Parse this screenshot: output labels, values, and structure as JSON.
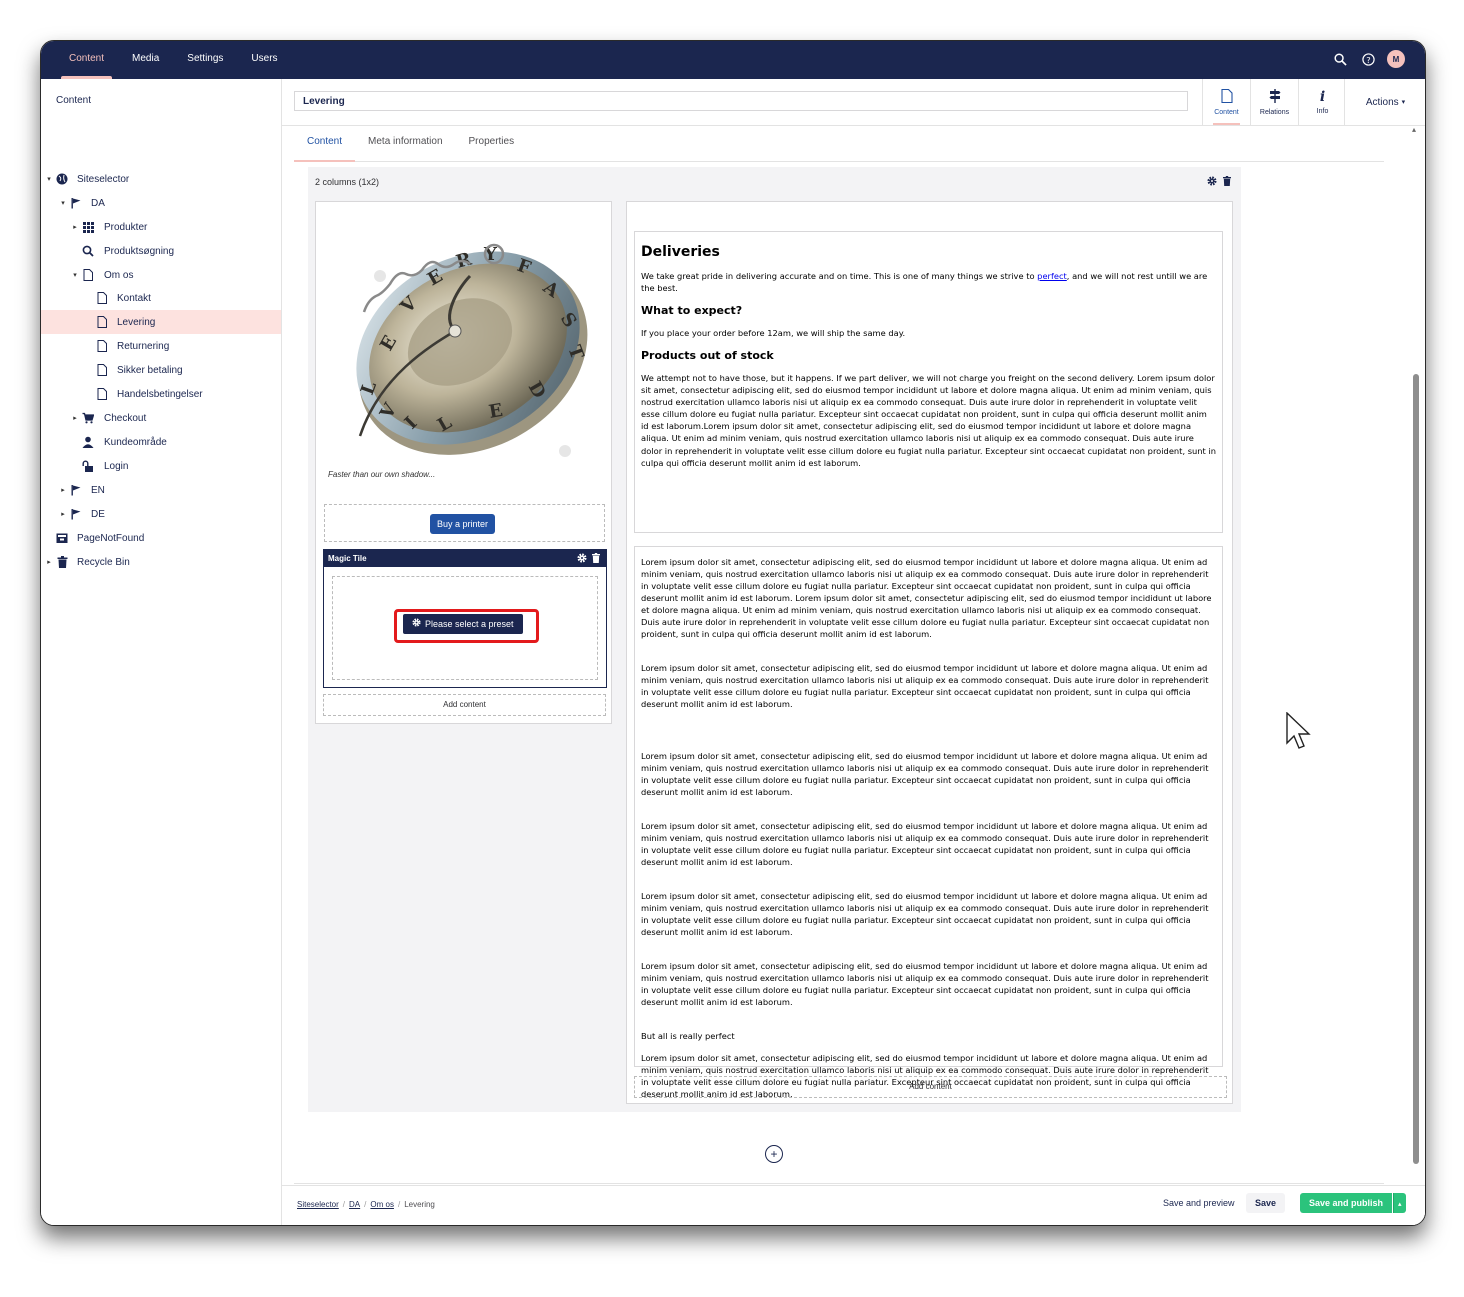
{
  "topnav": {
    "items": [
      {
        "label": "Content"
      },
      {
        "label": "Media"
      },
      {
        "label": "Settings"
      },
      {
        "label": "Users"
      }
    ],
    "avatar_initial": "M"
  },
  "sidebar": {
    "title": "Content",
    "tree": [
      {
        "label": "Siteselector",
        "icon": "globe-icon"
      },
      {
        "label": "DA",
        "icon": "flag-icon"
      },
      {
        "label": "Produkter",
        "icon": "grid-icon"
      },
      {
        "label": "Produktsøgning",
        "icon": "search-icon"
      },
      {
        "label": "Om os",
        "icon": "document-icon"
      },
      {
        "label": "Kontakt",
        "icon": "document-icon"
      },
      {
        "label": "Levering",
        "icon": "document-icon"
      },
      {
        "label": "Returnering",
        "icon": "document-icon"
      },
      {
        "label": "Sikker betaling",
        "icon": "document-icon"
      },
      {
        "label": "Handelsbetingelser",
        "icon": "document-icon"
      },
      {
        "label": "Checkout",
        "icon": "cart-icon"
      },
      {
        "label": "Kundeområde",
        "icon": "user-icon"
      },
      {
        "label": "Login",
        "icon": "unlock-icon"
      },
      {
        "label": "EN",
        "icon": "flag-icon"
      },
      {
        "label": "DE",
        "icon": "flag-icon"
      },
      {
        "label": "PageNotFound",
        "icon": "block-icon"
      },
      {
        "label": "Recycle Bin",
        "icon": "trash-icon"
      }
    ]
  },
  "header": {
    "name_value": "Levering",
    "apps": [
      {
        "label": "Content",
        "icon": "document-icon"
      },
      {
        "label": "Relations",
        "icon": "signpost-icon"
      },
      {
        "label": "Info",
        "icon": "info-icon"
      }
    ],
    "actions_label": "Actions"
  },
  "tabs": [
    {
      "label": "Content"
    },
    {
      "label": "Meta information"
    },
    {
      "label": "Properties"
    }
  ],
  "grid": {
    "row_title": "2 columns (1x2)",
    "left": {
      "watch_letters": "DELIVERY FAST",
      "caption": "Faster than our own shadow...",
      "button_label": "Buy a printer",
      "magic_tile_title": "Magic Tile",
      "preset_button_label": "Please select a preset",
      "add_content_label": "Add content"
    },
    "right": {
      "heading": "Deliveries",
      "intro_before_link": "We take great pride in delivering accurate and on time. This is one of many things we strive to ",
      "intro_link": "perfect",
      "intro_after_link": ", and we will not rest untill we are the best.",
      "subheading1": "What to expect?",
      "expect_text": "If you place your order before 12am, we will ship the same day.",
      "subheading2": "Products out of stock",
      "stock_text": "We attempt not to have those, but it happens. If we part deliver, we will not charge you freight on the second delivery. Lorem ipsum dolor sit amet, consectetur adipiscing elit, sed do eiusmod tempor incididunt ut labore et dolore magna aliqua. Ut enim ad minim veniam, quis nostrud exercitation ullamco laboris nisi ut aliquip ex ea commodo consequat. Duis aute irure dolor in reprehenderit in voluptate velit esse cillum dolore eu fugiat nulla pariatur. Excepteur sint occaecat cupidatat non proident, sunt in culpa qui officia deserunt mollit anim id est laborum.Lorem ipsum dolor sit amet, consectetur adipiscing elit, sed do eiusmod tempor incididunt ut labore et dolore magna aliqua. Ut enim ad minim veniam, quis nostrud exercitation ullamco laboris nisi ut aliquip ex ea commodo consequat. Duis aute irure dolor in reprehenderit in voluptate velit esse cillum dolore eu fugiat nulla pariatur. Excepteur sint occaecat cupidatat non proident, sunt in culpa qui officia deserunt mollit anim id est laborum.",
      "lorem_long": "Lorem ipsum dolor sit amet, consectetur adipiscing elit, sed do eiusmod tempor incididunt ut labore et dolore magna aliqua. Ut enim ad minim veniam, quis nostrud exercitation ullamco laboris nisi ut aliquip ex ea commodo consequat. Duis aute irure dolor in reprehenderit in voluptate velit esse cillum dolore eu fugiat nulla pariatur. Excepteur sint occaecat cupidatat non proident, sunt in culpa qui officia deserunt mollit anim id est laborum. Lorem ipsum dolor sit amet, consectetur adipiscing elit, sed do eiusmod tempor incididunt ut labore et dolore magna aliqua. Ut enim ad minim veniam, quis nostrud exercitation ullamco laboris nisi ut aliquip ex ea commodo consequat. Duis aute irure dolor in reprehenderit in voluptate velit esse cillum dolore eu fugiat nulla pariatur. Excepteur sint occaecat cupidatat non proident, sunt in culpa qui officia deserunt mollit anim id est laborum.",
      "lorem": "Lorem ipsum dolor sit amet, consectetur adipiscing elit, sed do eiusmod tempor incididunt ut labore et dolore magna aliqua. Ut enim ad minim veniam, quis nostrud exercitation ullamco laboris nisi ut aliquip ex ea commodo consequat. Duis aute irure dolor in reprehenderit in voluptate velit esse cillum dolore eu fugiat nulla pariatur. Excepteur sint occaecat cupidatat non proident, sunt in culpa qui officia deserunt mollit anim id est laborum.",
      "perfect_line": "But all is really perfect",
      "add_content_label": "Add content"
    }
  },
  "footer": {
    "breadcrumb": [
      "Siteselector",
      "DA",
      "Om os",
      "Levering"
    ],
    "save_preview_label": "Save and preview",
    "save_label": "Save",
    "publish_label": "Save and publish"
  },
  "colors": {
    "navy": "#1b264f",
    "accent_pink": "#f5c1bc",
    "active_row": "#fde2df",
    "publish_green": "#2bc37c",
    "highlight_red": "#e31a1c"
  }
}
